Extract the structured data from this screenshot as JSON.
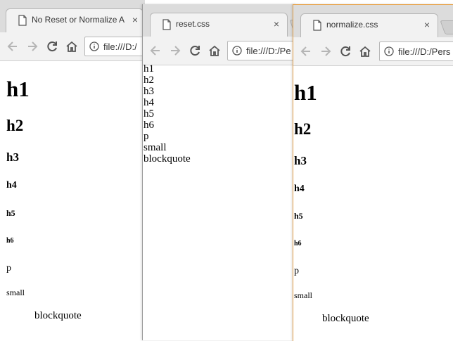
{
  "windows": {
    "a": {
      "tab_title": "No Reset or Normalize A",
      "url": "file:///D:/",
      "content": {
        "h1": "h1",
        "h2": "h2",
        "h3": "h3",
        "h4": "h4",
        "h5": "h5",
        "h6": "h6",
        "p": "p",
        "small": "small",
        "blockquote": "blockquote"
      }
    },
    "b": {
      "tab_title": "reset.css",
      "url": "file:///D:/Pe",
      "content": {
        "h1": "h1",
        "h2": "h2",
        "h3": "h3",
        "h4": "h4",
        "h5": "h5",
        "h6": "h6",
        "p": "p",
        "small": "small",
        "blockquote": "blockquote"
      }
    },
    "c": {
      "tab_title": "normalize.css",
      "url": "file:///D:/Pers",
      "content": {
        "h1": "h1",
        "h2": "h2",
        "h3": "h3",
        "h4": "h4",
        "h5": "h5",
        "h6": "h6",
        "p": "p",
        "small": "small",
        "blockquote": "blockquote"
      }
    }
  },
  "colors": {
    "active_border": "#e8a34a",
    "tabbar": "#dcdcdc",
    "toolbar": "#f2f2f2"
  }
}
